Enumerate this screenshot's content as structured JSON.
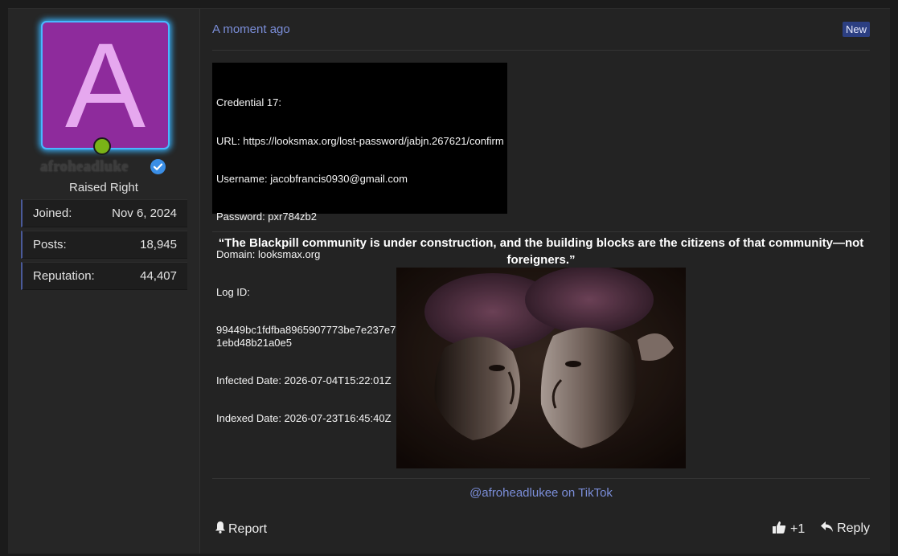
{
  "user": {
    "avatar_letter": "A",
    "username": "afroheadluke",
    "title": "Raised Right",
    "colors": {
      "avatar_bg": "#8e2b9c",
      "avatar_letter": "#e6a8ef",
      "glow": "#38b4ff",
      "online": "#7ab317",
      "verified": "#3a8ee6"
    },
    "stats": [
      {
        "label": "Joined:",
        "value": "Nov 6, 2024"
      },
      {
        "label": "Posts:",
        "value": "18,945"
      },
      {
        "label": "Reputation:",
        "value": "44,407"
      }
    ]
  },
  "post": {
    "timestamp": "A moment ago",
    "badge": "New",
    "credential_lines": [
      "Credential 17:",
      "URL: https://looksmax.org/lost-password/jabjn.267621/confirm",
      "Username: jacobfrancis0930@gmail.com",
      "Password: pxr784zb2",
      "Domain: looksmax.org",
      "Log ID:",
      "99449bc1fdfba8965907773be7e237e7c882c435427cf81e8051ebd48b21a0e5",
      "Infected Date: 2026-07-04T15:22:01Z",
      "Indexed Date: 2026-07-23T16:45:40Z"
    ],
    "quote": "“The Blackpill community is under construction, and the building blocks are the citizens of that community—not foreigners.”",
    "signature": "@afroheadlukee on TikTok"
  },
  "actions": {
    "report": "Report",
    "like_count": "+1",
    "reply": "Reply"
  }
}
